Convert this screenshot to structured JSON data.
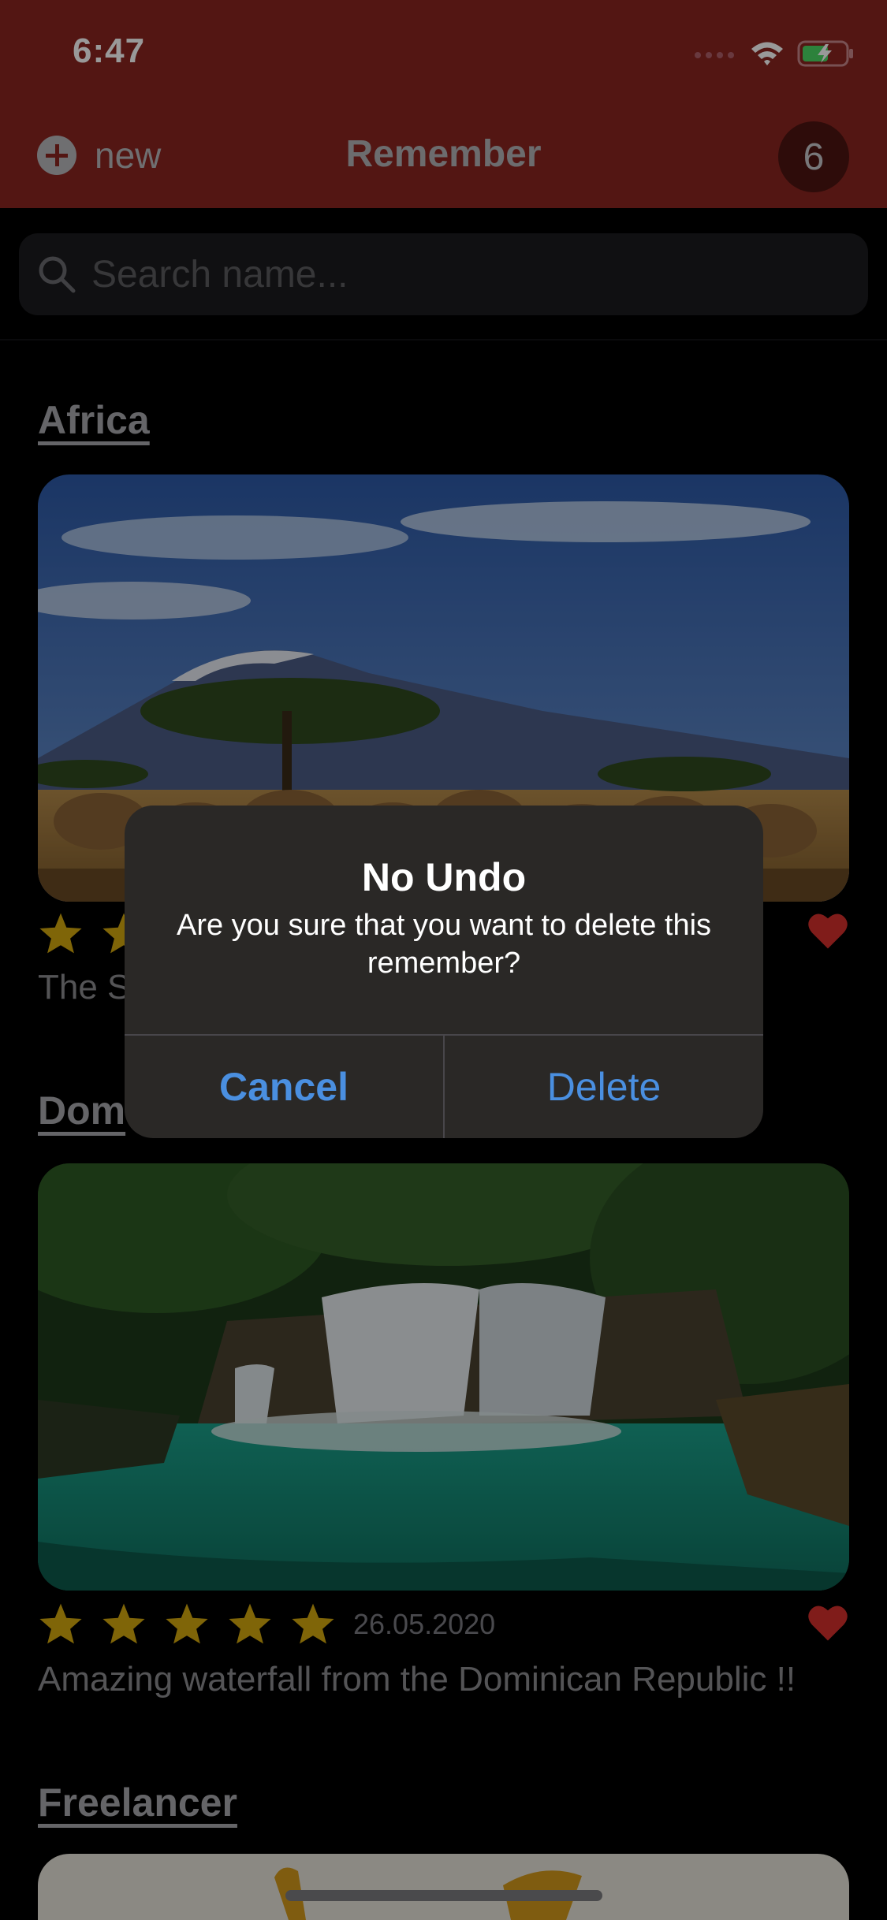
{
  "status_bar": {
    "time": "6:47"
  },
  "header": {
    "new_label": "new",
    "title": "Remember",
    "badge_count": "6",
    "bar_color": "#8b2520"
  },
  "search": {
    "placeholder": "Search name..."
  },
  "sections": [
    {
      "title": "Africa",
      "rating": 5,
      "date": "",
      "description": "The S",
      "favorite": true,
      "image": "savanna with elephants and mountain"
    },
    {
      "title": "Dom",
      "rating": 5,
      "date": "26.05.2020",
      "description": "Amazing waterfall from the Dominican Republic !!",
      "favorite": true,
      "image": "waterfall with turquoise pool"
    },
    {
      "title": "Freelancer",
      "image": "partially visible card"
    }
  ],
  "alert": {
    "title": "No Undo",
    "message": "Are you sure that you want to delete this remember?",
    "cancel_label": "Cancel",
    "delete_label": "Delete"
  },
  "colors": {
    "accent": "#4a8fe0",
    "star": "#d4a80e",
    "heart": "#d6302c"
  },
  "icons": [
    "wifi-icon",
    "battery-icon",
    "add-circle-icon",
    "search-icon",
    "star-icon",
    "heart-icon"
  ]
}
